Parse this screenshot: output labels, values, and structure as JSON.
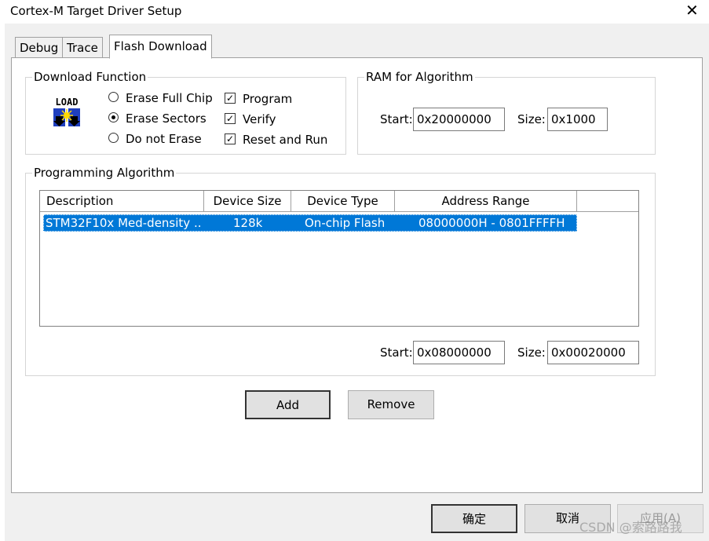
{
  "window": {
    "title": "Cortex-M Target Driver Setup"
  },
  "tabs": [
    "Debug",
    "Trace",
    "Flash Download"
  ],
  "download_function": {
    "title": "Download Function",
    "icon_label": "LOAD",
    "radios": [
      "Erase Full Chip",
      "Erase Sectors",
      "Do not Erase"
    ],
    "selected_radio": "Erase Sectors",
    "checks": [
      {
        "label": "Program",
        "checked": true
      },
      {
        "label": "Verify",
        "checked": true
      },
      {
        "label": "Reset and Run",
        "checked": true
      }
    ]
  },
  "ram": {
    "title": "RAM for Algorithm",
    "start_label": "Start:",
    "start_value": "0x20000000",
    "size_label": "Size:",
    "size_value": "0x1000"
  },
  "programming": {
    "title": "Programming Algorithm",
    "columns": [
      "Description",
      "Device Size",
      "Device Type",
      "Address Range"
    ],
    "rows": [
      {
        "description": "STM32F10x Med-density ...",
        "size": "128k",
        "type": "On-chip Flash",
        "range": "08000000H - 0801FFFFH"
      }
    ],
    "start_label": "Start:",
    "start_value": "0x08000000",
    "size_label": "Size:",
    "size_value": "0x00020000"
  },
  "buttons": {
    "add": "Add",
    "remove": "Remove"
  },
  "footer": {
    "ok": "确定",
    "cancel": "取消",
    "apply": "应用(A)"
  },
  "watermark": "CSDN @索路路我"
}
